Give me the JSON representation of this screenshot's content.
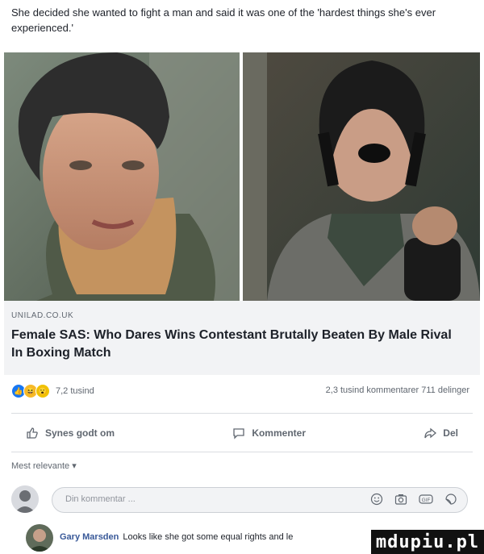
{
  "caption": "She decided she wanted to fight a man and said it was one of the 'hardest things she's ever experienced.'",
  "link": {
    "domain": "UNILAD.CO.UK",
    "headline": "Female SAS: Who Dares Wins Contestant Brutally Beaten By Male Rival In Boxing Match"
  },
  "stats": {
    "reactions_count": "7,2 tusind",
    "comments_shares": "2,3 tusind kommentarer  711 delinger",
    "reaction_icons": [
      "like-icon",
      "haha-icon",
      "wow-icon"
    ]
  },
  "actions": {
    "like": "Synes godt om",
    "comment": "Kommenter",
    "share": "Del"
  },
  "sort_label": "Mest relevante ▾",
  "comment_input": {
    "placeholder": "Din kommentar ..."
  },
  "comments": [
    {
      "author": "Gary Marsden",
      "text": "Looks like she got some equal rights and le"
    }
  ],
  "watermark": "mdupiu.pl",
  "colors": {
    "link_blue": "#385898",
    "gray_text": "#606770",
    "box_bg": "#f2f3f5",
    "like_blue": "#1877f2"
  }
}
